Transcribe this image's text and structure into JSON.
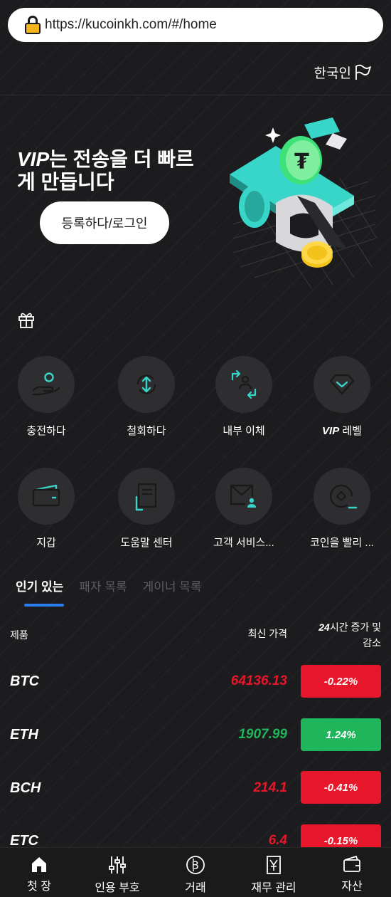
{
  "browser": {
    "url": "https://kucoinkh.com/#/home"
  },
  "header": {
    "language": "한국인"
  },
  "hero": {
    "title_vip": "VIP",
    "title_rest": "는 전송을 더 빠르게 만듭니다",
    "login_button": "등록하다/로그인"
  },
  "grid": {
    "items": [
      {
        "label": "충전하다",
        "icon": "deposit-icon"
      },
      {
        "label": "철회하다",
        "icon": "withdraw-icon"
      },
      {
        "label": "내부 이체",
        "icon": "transfer-icon"
      },
      {
        "label_vip": "VIP",
        "label_rest": " 레벨",
        "icon": "diamond-icon"
      },
      {
        "label": "지갑",
        "icon": "wallet-icon"
      },
      {
        "label": "도움말 센터",
        "icon": "document-icon"
      },
      {
        "label": "고객 서비스...",
        "icon": "mail-user-icon"
      },
      {
        "label": "코인을 빨리 ...",
        "icon": "coin-swap-icon"
      }
    ]
  },
  "tabs": [
    {
      "label": "인기 있는",
      "active": true
    },
    {
      "label": "패자 목록",
      "active": false
    },
    {
      "label": "게이너 목록",
      "active": false
    }
  ],
  "table": {
    "headers": {
      "product": "제품",
      "price": "최신 가격",
      "change_line1": "24시간 증가 및",
      "change_line2": "감소"
    },
    "rows": [
      {
        "symbol": "BTC",
        "price": "64136.13",
        "change": "-0.22%",
        "direction": "down"
      },
      {
        "symbol": "ETH",
        "price": "1907.99",
        "change": "1.24%",
        "direction": "up"
      },
      {
        "symbol": "BCH",
        "price": "214.1",
        "change": "-0.41%",
        "direction": "down"
      },
      {
        "symbol": "ETC",
        "price": "6.4",
        "change": "-0.15%",
        "direction": "down"
      }
    ]
  },
  "bottom_nav": [
    {
      "label": "첫 장",
      "icon": "home-icon"
    },
    {
      "label": "인용 부호",
      "icon": "sliders-icon"
    },
    {
      "label": "거래",
      "icon": "bitcoin-icon"
    },
    {
      "label": "재무 관리",
      "icon": "finance-icon"
    },
    {
      "label": "자산",
      "icon": "wallet-icon"
    }
  ],
  "colors": {
    "up": "#1fb55a",
    "down": "#e8162a",
    "accent": "#2a7df0",
    "teal": "#37d6c8"
  }
}
